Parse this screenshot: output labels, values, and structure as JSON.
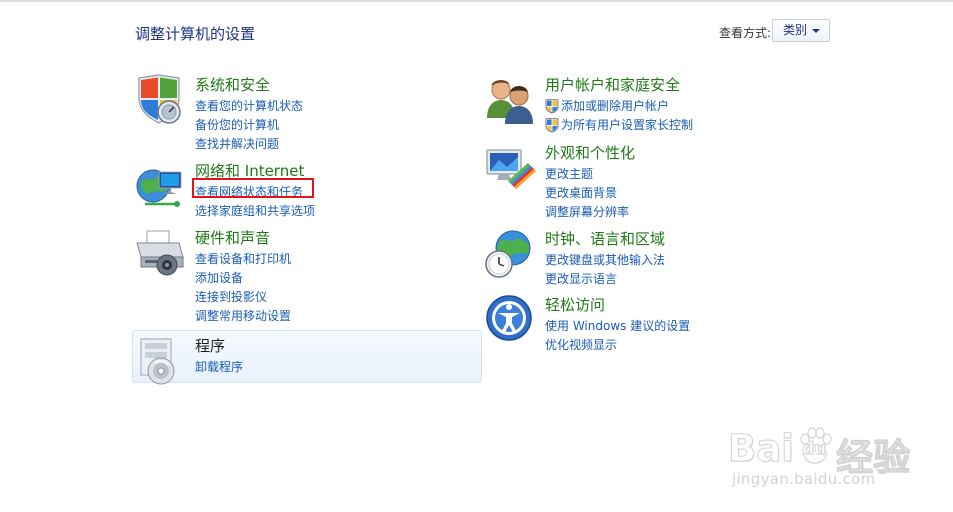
{
  "header": {
    "title": "调整计算机的设置",
    "view_by_label": "查看方式:",
    "view_by_value": "类别"
  },
  "left_column": [
    {
      "title": "系统和安全",
      "icon": "shield-monitor-icon",
      "links": [
        "查看您的计算机状态",
        "备份您的计算机",
        "查找并解决问题"
      ]
    },
    {
      "title": "网络和 Internet",
      "icon": "globe-network-icon",
      "links": [
        "查看网络状态和任务",
        "选择家庭组和共享选项"
      ]
    },
    {
      "title": "硬件和声音",
      "icon": "printer-icon",
      "links": [
        "查看设备和打印机",
        "添加设备",
        "连接到投影仪",
        "调整常用移动设置"
      ]
    },
    {
      "title": "程序",
      "icon": "programs-icon",
      "links": [
        "卸载程序"
      ]
    }
  ],
  "right_column": [
    {
      "title": "用户帐户和家庭安全",
      "icon": "users-icon",
      "links": [
        "添加或删除用户帐户",
        "为所有用户设置家长控制"
      ]
    },
    {
      "title": "外观和个性化",
      "icon": "monitor-palette-icon",
      "links": [
        "更改主题",
        "更改桌面背景",
        "调整屏幕分辨率"
      ]
    },
    {
      "title": "时钟、语言和区域",
      "icon": "clock-globe-icon",
      "links": [
        "更改键盘或其他输入法",
        "更改显示语言"
      ]
    },
    {
      "title": "轻松访问",
      "icon": "ease-of-access-icon",
      "links": [
        "使用 Windows 建议的设置",
        "优化视频显示"
      ]
    }
  ],
  "watermark": {
    "brand_left": "Bai",
    "brand_mid": "du",
    "brand_right": "经验",
    "url": "jingyan.baidu.com"
  },
  "colors": {
    "category_title": "#1f7a16",
    "link": "#1a5cb6",
    "highlight_box": "#e0151b"
  }
}
